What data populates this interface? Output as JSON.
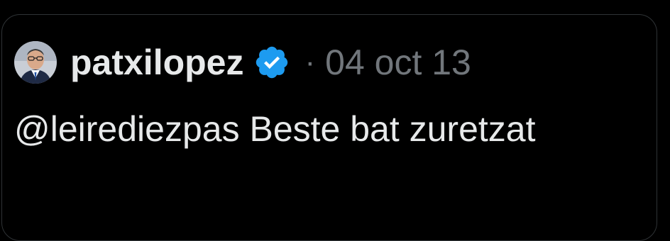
{
  "quoted_tweet": {
    "author": {
      "username": "patxilopez",
      "verified": true,
      "avatar_icon": "profile-photo"
    },
    "separator": "·",
    "date": "04 oct 13",
    "text": "@leirediezpas Beste bat zuretzat"
  },
  "colors": {
    "background": "#000000",
    "border": "#2f3336",
    "primary_text": "#e7e9ea",
    "secondary_text": "#71767b",
    "verified_badge": "#1d9bf0"
  }
}
